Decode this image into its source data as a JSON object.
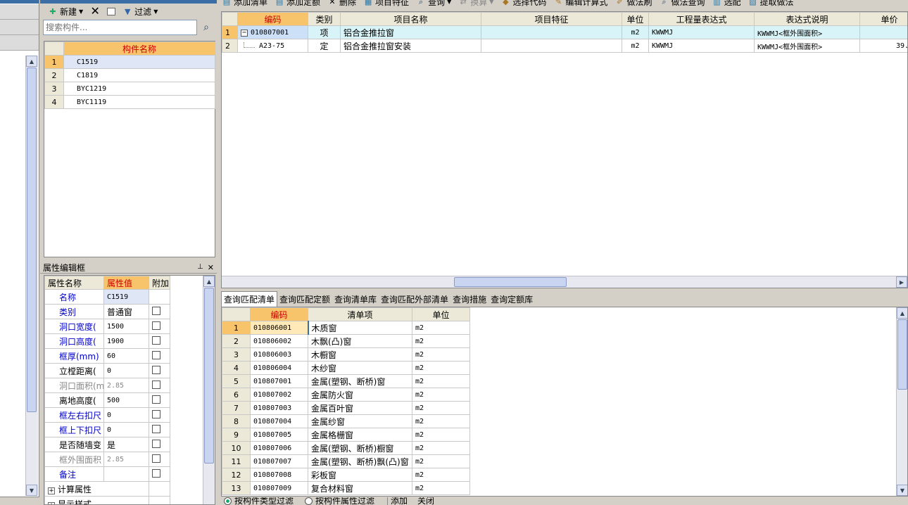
{
  "left_toolbar": {
    "new_label": "新建",
    "filter_label": "过滤"
  },
  "component_search": {
    "placeholder": "搜索构件..."
  },
  "component_list": {
    "header": "构件名称",
    "rows": [
      {
        "n": "1",
        "name": "C1519"
      },
      {
        "n": "2",
        "name": "C1819"
      },
      {
        "n": "3",
        "name": "BYC1219"
      },
      {
        "n": "4",
        "name": "BYC1119"
      }
    ]
  },
  "property_panel": {
    "title": "属性编辑框",
    "headers": [
      "属性名称",
      "属性值",
      "附加"
    ],
    "rows": [
      {
        "name": "名称",
        "value": "C1519"
      },
      {
        "name": "类别",
        "value": "普通窗"
      },
      {
        "name": "洞口宽度(",
        "value": "1500"
      },
      {
        "name": "洞口高度(",
        "value": "1900"
      },
      {
        "name": "框厚(mm)",
        "value": "60"
      },
      {
        "name": "立樘距离(",
        "value": "0"
      },
      {
        "name": "洞口面积(m",
        "value": "2.85"
      },
      {
        "name": "离地高度(",
        "value": "500"
      },
      {
        "name": "框左右扣尺",
        "value": "0"
      },
      {
        "name": "框上下扣尺",
        "value": "0"
      },
      {
        "name": "是否随墙变",
        "value": "是"
      },
      {
        "name": "框外围面积",
        "value": "2.85"
      },
      {
        "name": "备注",
        "value": ""
      }
    ],
    "groups": [
      "计算属性",
      "显示样式"
    ]
  },
  "main_toolbar": {
    "items": [
      "添加清单",
      "添加定额",
      "删除",
      "项目特征",
      "查询",
      "换算",
      "选择代码",
      "编辑计算式",
      "做法刷",
      "做法查询",
      "选配",
      "提取做法"
    ]
  },
  "top_table": {
    "headers": [
      "编码",
      "类别",
      "项目名称",
      "项目特征",
      "单位",
      "工程量表达式",
      "表达式说明",
      "单价"
    ],
    "rows": [
      {
        "n": "1",
        "code": "010807001",
        "type": "项",
        "name": "铝合金推拉窗",
        "feature": "",
        "unit": "m2",
        "expr": "KWWMJ",
        "desc": "KWWMJ<框外围面积>",
        "price": ""
      },
      {
        "n": "2",
        "code": "A23-75",
        "type": "定",
        "name": "铝合金推拉窗安装",
        "feature": "",
        "unit": "m2",
        "expr": "KWWMJ",
        "desc": "KWWMJ<框外围面积>",
        "price": "39."
      }
    ]
  },
  "query_tabs": [
    "查询匹配清单",
    "查询匹配定额",
    "查询清单库",
    "查询匹配外部清单",
    "查询措施",
    "查询定额库"
  ],
  "query_table": {
    "headers": [
      "编码",
      "清单项",
      "单位"
    ],
    "rows": [
      {
        "n": "1",
        "code": "010806001",
        "item": "木质窗",
        "unit": "m2"
      },
      {
        "n": "2",
        "code": "010806002",
        "item": "木飘(凸)窗",
        "unit": "m2"
      },
      {
        "n": "3",
        "code": "010806003",
        "item": "木橱窗",
        "unit": "m2"
      },
      {
        "n": "4",
        "code": "010806004",
        "item": "木纱窗",
        "unit": "m2"
      },
      {
        "n": "5",
        "code": "010807001",
        "item": "金属(塑钢、断桥)窗",
        "unit": "m2"
      },
      {
        "n": "6",
        "code": "010807002",
        "item": "金属防火窗",
        "unit": "m2"
      },
      {
        "n": "7",
        "code": "010807003",
        "item": "金属百叶窗",
        "unit": "m2"
      },
      {
        "n": "8",
        "code": "010807004",
        "item": "金属纱窗",
        "unit": "m2"
      },
      {
        "n": "9",
        "code": "010807005",
        "item": "金属格栅窗",
        "unit": "m2"
      },
      {
        "n": "10",
        "code": "010807006",
        "item": "金属(塑钢、断桥)橱窗",
        "unit": "m2"
      },
      {
        "n": "11",
        "code": "010807007",
        "item": "金属(塑钢、断桥)飘(凸)窗",
        "unit": "m2"
      },
      {
        "n": "12",
        "code": "010807008",
        "item": "彩板窗",
        "unit": "m2"
      },
      {
        "n": "13",
        "code": "010807009",
        "item": "复合材料窗",
        "unit": "m2"
      }
    ]
  },
  "bottom_bar": {
    "filter_by_type": "按构件类型过滤",
    "filter_by_attr": "按构件属性过滤",
    "add": "添加",
    "close": "关闭"
  }
}
